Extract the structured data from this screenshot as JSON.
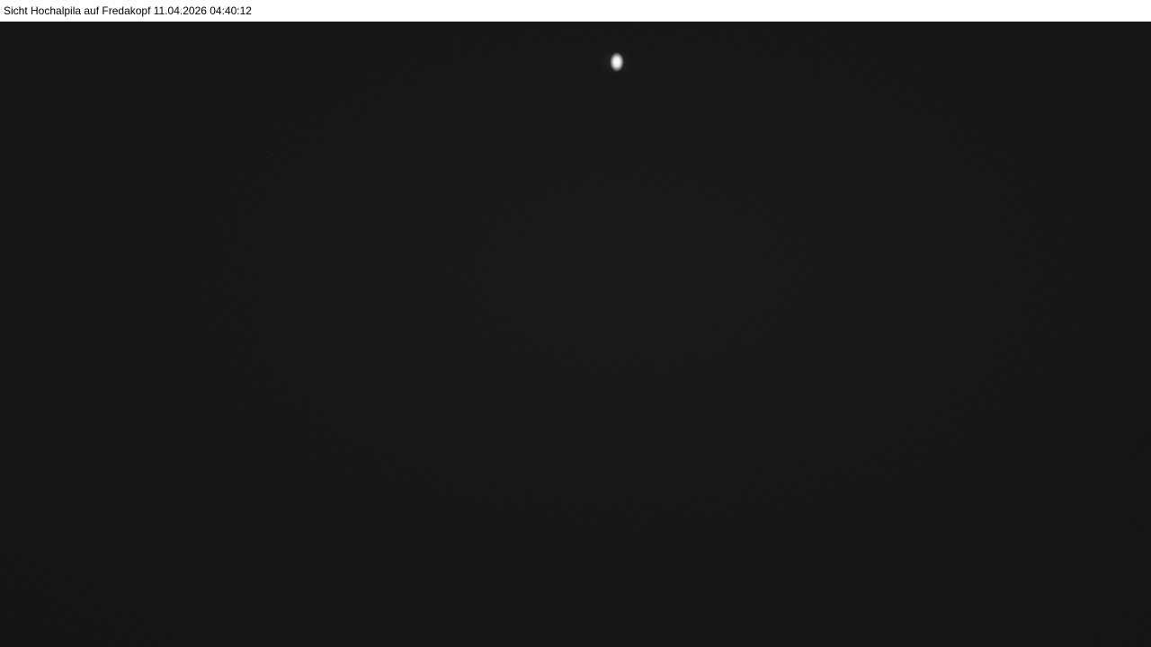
{
  "caption": {
    "text": "Sicht Hochalpila auf Fredakopf 11.04.2026 04:40:12"
  },
  "scene": {
    "description_colors": {
      "sky": "#0b0b0b",
      "caption_bg": "#ffffff",
      "caption_text": "#000000",
      "light_point": "#ffffff"
    }
  }
}
